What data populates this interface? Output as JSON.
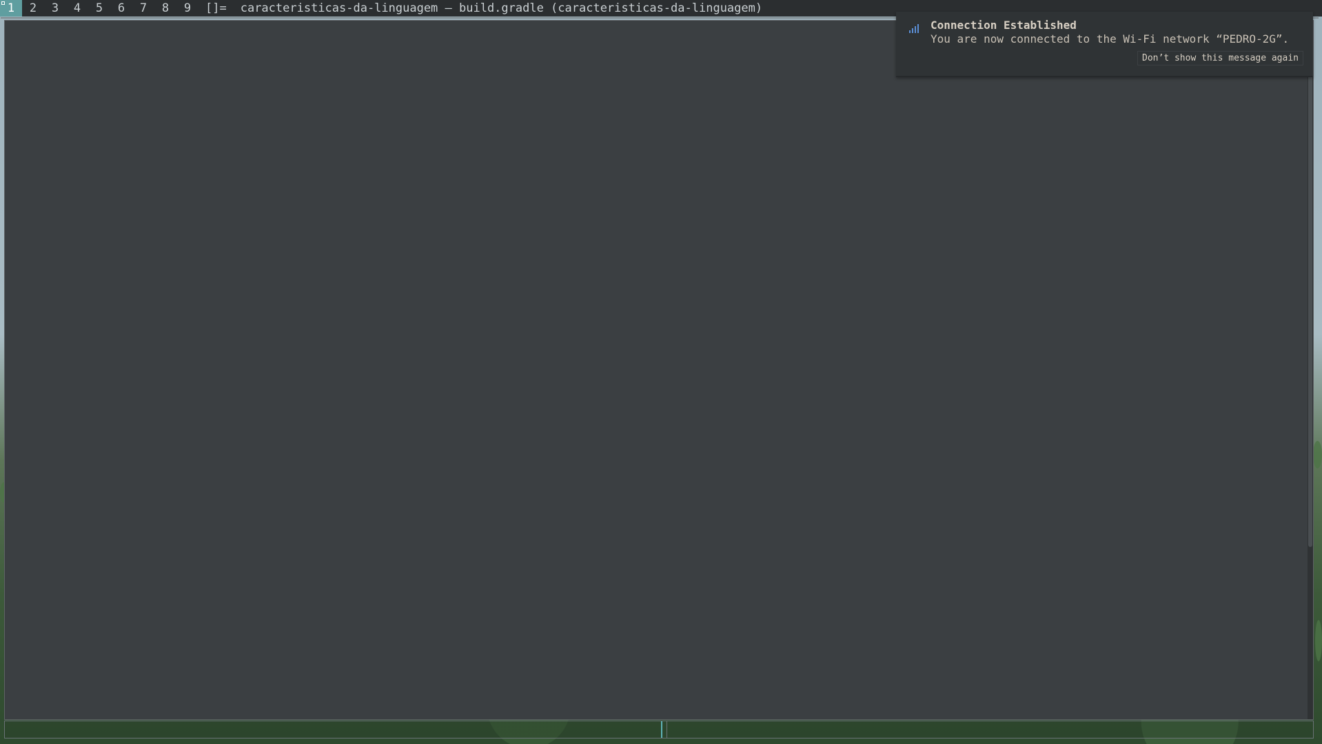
{
  "topbar": {
    "tags": [
      {
        "label": "1",
        "active": true
      },
      {
        "label": "2",
        "active": false
      },
      {
        "label": "3",
        "active": false
      },
      {
        "label": "4",
        "active": false
      },
      {
        "label": "5",
        "active": false
      },
      {
        "label": "6",
        "active": false
      },
      {
        "label": "7",
        "active": false
      },
      {
        "label": "8",
        "active": false
      },
      {
        "label": "9",
        "active": false
      }
    ],
    "layout_symbol": "[]=",
    "window_title": "caracteristicas-da-linguagem – build.gradle (caracteristicas-da-linguagem)"
  },
  "notification": {
    "icon": "wifi-signal-icon",
    "title": "Connection Established",
    "body": "You are now connected to the Wi-Fi network “PEDRO-2G”.",
    "action_label": "Don’t show this message again"
  },
  "colors": {
    "tag_active_bg": "#5f9ea0",
    "topbar_bg": "#2b2e30",
    "window_bg": "#3b3f42",
    "notification_bg": "#2f3335",
    "wifi_icon": "#5b8fd6"
  }
}
